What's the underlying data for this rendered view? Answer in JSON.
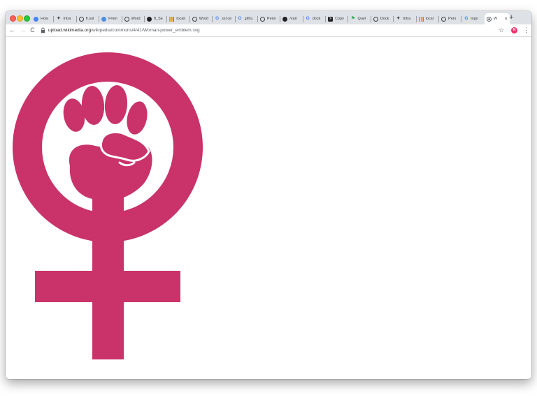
{
  "window": {
    "traffic_lights": [
      "close",
      "minimize",
      "maximize"
    ]
  },
  "tabs": [
    {
      "title": "How",
      "icon": "blue-circle-icon",
      "color": "#4285f4"
    },
    {
      "title": "Intra",
      "icon": "kubernetes-icon",
      "color": "#3c4043"
    },
    {
      "title": "fr.sol",
      "icon": "globe-icon",
      "color": "#3c4043"
    },
    {
      "title": "Frien",
      "icon": "chat-bubble-icon",
      "color": "#4a90e2"
    },
    {
      "title": "Word",
      "icon": "globe-icon",
      "color": "#3c4043"
    },
    {
      "title": "ft_Se",
      "icon": "github-icon",
      "color": "#202124"
    },
    {
      "title": "locali",
      "icon": "bar-chart-icon",
      "color": "#f29900"
    },
    {
      "title": "Word",
      "icon": "globe-icon",
      "color": "#3c4043"
    },
    {
      "title": "ssl ce",
      "icon": "google-icon",
      "color": "#4285f4"
    },
    {
      "title": "githu",
      "icon": "google-icon",
      "color": "#4285f4"
    },
    {
      "title": "Persi",
      "icon": "globe-icon",
      "color": "#3c4043"
    },
    {
      "title": "/vari",
      "icon": "github-icon",
      "color": "#202124"
    },
    {
      "title": "dock",
      "icon": "google-icon",
      "color": "#4285f4"
    },
    {
      "title": "Copy",
      "icon": "terminal-icon",
      "color": "#202124"
    },
    {
      "title": "Quel",
      "icon": "flag-icon",
      "color": "#34a853"
    },
    {
      "title": "Dock",
      "icon": "globe-icon",
      "color": "#3c4043"
    },
    {
      "title": "Intra",
      "icon": "kubernetes-icon",
      "color": "#3c4043"
    },
    {
      "title": "local",
      "icon": "bar-chart-icon",
      "color": "#f29900"
    },
    {
      "title": "Pers",
      "icon": "globe-icon",
      "color": "#3c4043"
    },
    {
      "title": "logo",
      "icon": "google-icon",
      "color": "#4285f4"
    }
  ],
  "active_tab": {
    "title": "W",
    "icon": "wikimedia-icon",
    "close": "×"
  },
  "new_tab_label": "+",
  "toolbar": {
    "back": "←",
    "forward": "→",
    "reload": "C",
    "url_host": "upload.wikimedia.org",
    "url_path": "/wikipedia/commons/4/41/Woman-power_emblem.svg",
    "star": "☆",
    "avatar_initial": "N",
    "menu": "⋮"
  },
  "content": {
    "image": "woman-power-emblem",
    "emblem_color": "#c9336a",
    "background": "#ffffff"
  }
}
